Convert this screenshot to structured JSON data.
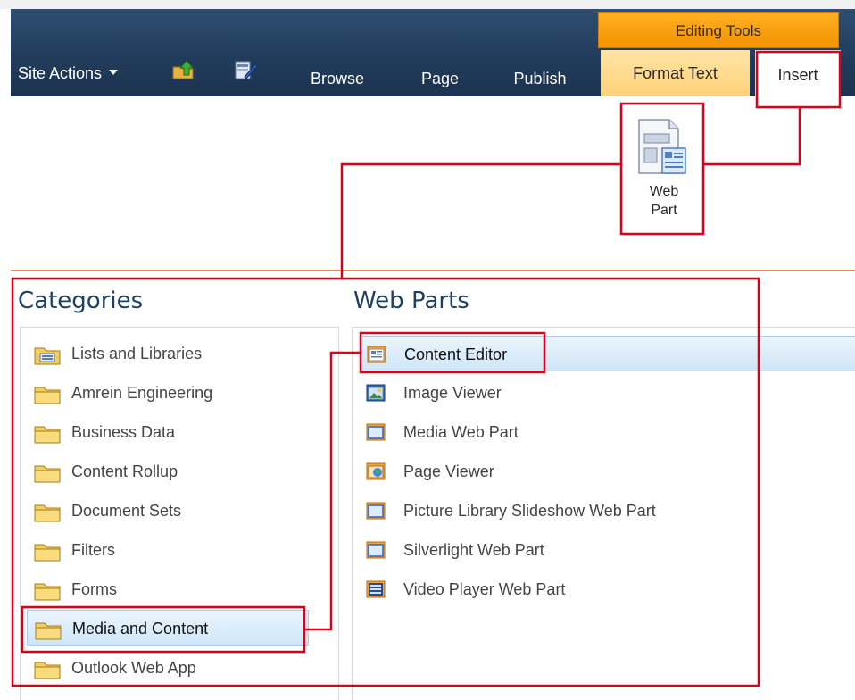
{
  "ribbon": {
    "contextual_group": "Editing Tools",
    "tabs": {
      "site_actions": "Site Actions",
      "browse": "Browse",
      "page": "Page",
      "publish": "Publish",
      "format_text": "Format Text",
      "insert": "Insert"
    },
    "icons": {
      "navigate_up": "navigate-up-icon",
      "edit_page": "edit-page-icon"
    },
    "web_part_button": {
      "label_line1": "Web",
      "label_line2": "Part",
      "icon": "web-part-icon"
    }
  },
  "panel": {
    "categories_heading": "Categories",
    "web_parts_heading": "Web Parts",
    "categories": [
      {
        "label": "Lists and Libraries",
        "selected": false
      },
      {
        "label": "Amrein Engineering",
        "selected": false
      },
      {
        "label": "Business Data",
        "selected": false
      },
      {
        "label": "Content Rollup",
        "selected": false
      },
      {
        "label": "Document Sets",
        "selected": false
      },
      {
        "label": "Filters",
        "selected": false
      },
      {
        "label": "Forms",
        "selected": false
      },
      {
        "label": "Media and Content",
        "selected": true
      },
      {
        "label": "Outlook Web App",
        "selected": false
      }
    ],
    "web_parts": [
      {
        "label": "Content Editor",
        "icon": "content-editor-icon",
        "selected": true
      },
      {
        "label": "Image Viewer",
        "icon": "image-viewer-icon",
        "selected": false
      },
      {
        "label": "Media Web Part",
        "icon": "media-web-part-icon",
        "selected": false
      },
      {
        "label": "Page Viewer",
        "icon": "page-viewer-icon",
        "selected": false
      },
      {
        "label": "Picture Library Slideshow Web Part",
        "icon": "slideshow-icon",
        "selected": false
      },
      {
        "label": "Silverlight Web Part",
        "icon": "silverlight-icon",
        "selected": false
      },
      {
        "label": "Video Player Web Part",
        "icon": "video-player-icon",
        "selected": false
      }
    ]
  },
  "colors": {
    "ribbon_dark": "#213c5b",
    "contextual_orange": "#f39200",
    "annotation_red": "#d9001b",
    "selection_blue": "#cfe6f8"
  }
}
